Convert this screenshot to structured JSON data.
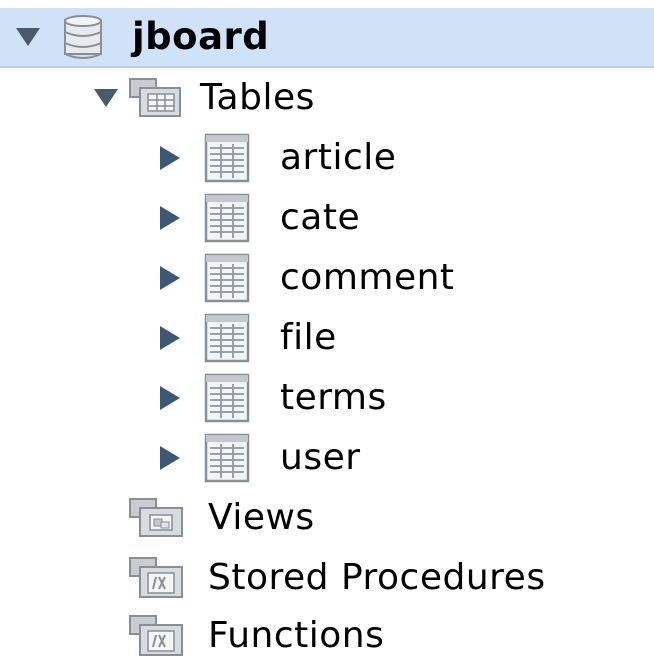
{
  "tree": {
    "schema": {
      "label": "jboard",
      "expanded": true,
      "selected": true,
      "icon": "database-icon"
    },
    "tables_group": {
      "label": "Tables",
      "expanded": true,
      "icon": "folder-tables-icon",
      "items": [
        {
          "label": "article",
          "icon": "table-icon",
          "expanded": false
        },
        {
          "label": "cate",
          "icon": "table-icon",
          "expanded": false
        },
        {
          "label": "comment",
          "icon": "table-icon",
          "expanded": false
        },
        {
          "label": "file",
          "icon": "table-icon",
          "expanded": false
        },
        {
          "label": "terms",
          "icon": "table-icon",
          "expanded": false
        },
        {
          "label": "user",
          "icon": "table-icon",
          "expanded": false
        }
      ]
    },
    "views_group": {
      "label": "Views",
      "icon": "folder-views-icon"
    },
    "procedures_group": {
      "label": "Stored Procedures",
      "icon": "folder-procedures-icon"
    },
    "functions_group": {
      "label": "Functions",
      "icon": "folder-functions-icon"
    }
  },
  "colors": {
    "selection_background": "#cfe2f7",
    "arrow": "#3d5877",
    "icon_gray": "#8a8f96"
  }
}
